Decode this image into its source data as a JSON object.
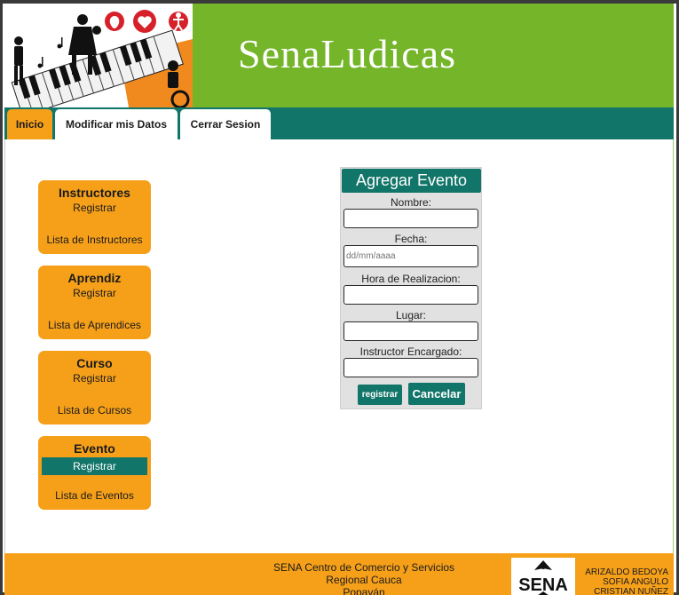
{
  "header": {
    "site_title": "SenaLudicas"
  },
  "nav": {
    "tabs": [
      {
        "label": "Inicio"
      },
      {
        "label": "Modificar mis Datos"
      },
      {
        "label": "Cerrar Sesion"
      }
    ],
    "active_tab": "Inicio"
  },
  "sidebar": {
    "sections": [
      {
        "title": "Instructores",
        "register": "Registrar",
        "list": "Lista de Instructores"
      },
      {
        "title": "Aprendiz",
        "register": "Registrar",
        "list": "Lista de Aprendices"
      },
      {
        "title": "Curso",
        "register": "Registrar",
        "list": "Lista de Cursos"
      },
      {
        "title": "Evento",
        "register": "Registrar",
        "list": "Lista de Eventos"
      }
    ]
  },
  "form": {
    "title": "Agregar Evento",
    "fields": [
      {
        "label": "Nombre:",
        "value": "",
        "placeholder": ""
      },
      {
        "label": "Fecha:",
        "value": "",
        "placeholder": "dd/mm/aaaa"
      },
      {
        "label": "Hora de Realizacion:",
        "value": "",
        "placeholder": ""
      },
      {
        "label": "Lugar:",
        "value": "",
        "placeholder": ""
      },
      {
        "label": "Instructor Encargado:",
        "value": "",
        "placeholder": ""
      }
    ],
    "submit_label": "registrar",
    "cancel_label": "Cancelar"
  },
  "footer": {
    "lines": [
      "SENA Centro de Comercio y Servicios",
      "Regional Cauca",
      "Popayán"
    ],
    "logo_text": "SENA",
    "credits": [
      "ARIZALDO BEDOYA",
      "SOFIA ANGULO",
      "CRISTIAN NUÑEZ"
    ]
  },
  "colors": {
    "header_green": "#74b52a",
    "nav_teal": "#127569",
    "orange": "#f6a01a"
  }
}
